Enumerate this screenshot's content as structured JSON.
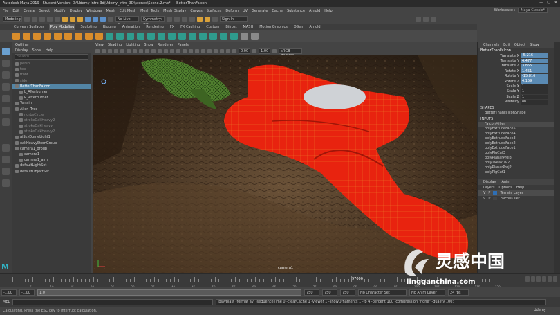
{
  "titlebar": {
    "title": "Autodesk Maya 2019 - Student Version: D:\\Udemy Intro 3d\\Udemy_Intro_3D\\scenes\\Scene.2.mb*   ---   BetterThanFalcon",
    "controls": [
      "—",
      "▢",
      "✕"
    ]
  },
  "menubar": {
    "items": [
      "File",
      "Edit",
      "Create",
      "Select",
      "Modify",
      "Display",
      "Windows",
      "Mesh",
      "Edit Mesh",
      "Mesh Tools",
      "Mesh Display",
      "Curves",
      "Surfaces",
      "Deform",
      "UV",
      "Generate",
      "Cache",
      "Substance",
      "Arnold",
      "Help"
    ],
    "workspace_label": "Workspace :",
    "workspace_value": "Maya Classic*"
  },
  "statusline": {
    "mode": "Modeling",
    "live_surface": "No Live Surface",
    "symmetry": "Symmetry: Off",
    "signin": "Sign In"
  },
  "shelf": {
    "tabs": [
      "Curves / Surfaces",
      "Poly Modeling",
      "Sculpting",
      "Rigging",
      "Animation",
      "Rendering",
      "FX",
      "FX Caching",
      "Custom",
      "Bifrost",
      "MASH",
      "Motion Graphics",
      "XGen",
      "Arnold"
    ],
    "active_tab": "Poly Modeling"
  },
  "outliner": {
    "title": "Outliner",
    "menu": [
      "Display",
      "Show",
      "Help"
    ],
    "search_placeholder": "Search...",
    "items": [
      {
        "label": "persp",
        "dim": true,
        "sel": false
      },
      {
        "label": "top",
        "dim": true,
        "sel": false
      },
      {
        "label": "front",
        "dim": true,
        "sel": false
      },
      {
        "label": "side",
        "dim": true,
        "sel": false
      },
      {
        "label": "BetterThanFalcon",
        "dim": false,
        "sel": true
      },
      {
        "label": "L_Afterburner",
        "dim": false,
        "sel": false
      },
      {
        "label": "R_Afterburner",
        "dim": false,
        "sel": false
      },
      {
        "label": "Terrain",
        "dim": false,
        "sel": false
      },
      {
        "label": "Alien_Tree",
        "dim": false,
        "sel": false
      },
      {
        "label": "nurbsCircle",
        "dim": true,
        "sel": false
      },
      {
        "label": "strokeOakHeavy2",
        "dim": true,
        "sel": false
      },
      {
        "label": "strokeOakHeavy",
        "dim": true,
        "sel": false
      },
      {
        "label": "strokeOakHeavy2",
        "dim": true,
        "sel": false
      },
      {
        "label": "aiSkyDomeLight1",
        "dim": false,
        "sel": false
      },
      {
        "label": "oakHeavyStemGroup",
        "dim": false,
        "sel": false
      },
      {
        "label": "camera1_group",
        "dim": false,
        "sel": false
      },
      {
        "label": "camera1",
        "dim": false,
        "sel": false
      },
      {
        "label": "camera1_aim",
        "dim": false,
        "sel": false
      },
      {
        "label": "defaultLightSet",
        "dim": false,
        "sel": false
      },
      {
        "label": "defaultObjectSet",
        "dim": false,
        "sel": false
      }
    ]
  },
  "viewport": {
    "menu": [
      "View",
      "Shading",
      "Lighting",
      "Show",
      "Renderer",
      "Panels"
    ],
    "field_value": "0.00",
    "field_value2": "1.00",
    "colorspace": "sRGB gamma",
    "camera_label": "camera1"
  },
  "channelbox": {
    "menu": [
      "Channels",
      "Edit",
      "Object",
      "Show"
    ],
    "object": "BetterThanFalcon",
    "channels": [
      {
        "name": "Translate X",
        "value": "-5.216"
      },
      {
        "name": "Translate Y",
        "value": "4.477"
      },
      {
        "name": "Translate Z",
        "value": "3.855"
      },
      {
        "name": "Rotate X",
        "value": "1.451"
      },
      {
        "name": "Rotate Y",
        "value": "-15.816"
      },
      {
        "name": "Rotate Z",
        "value": "4.159"
      },
      {
        "name": "Scale X",
        "value": "1"
      },
      {
        "name": "Scale Y",
        "value": "1"
      },
      {
        "name": "Scale Z",
        "value": "1"
      },
      {
        "name": "Visibility",
        "value": "on"
      }
    ],
    "shapes_label": "SHAPES",
    "shape_name": "BetterThanFalconShape",
    "inputs_label": "INPUTS",
    "inputs": [
      "FalconMiller",
      "polyExtrudeFace5",
      "polyExtrudeFace4",
      "polyExtrudeFace3",
      "polyExtrudeFace2",
      "polyExtrudeFace1",
      "polyPlgCut3",
      "polyPlanarProj3",
      "polyTweakUV2",
      "polyPlanarProj2",
      "polyPlgCut1"
    ],
    "layer_tabs": [
      "Display",
      "Anim"
    ],
    "layer_menu": [
      "Layers",
      "Options",
      "Help"
    ],
    "layers": [
      {
        "vis": "V",
        "p": "P",
        "name": "Terrain_Layer",
        "color": "#2e6fb5"
      },
      {
        "vis": "V",
        "p": "P",
        "name": "FalconKiller",
        "color": "#444444"
      }
    ]
  },
  "timeslider": {
    "tick_labels": [
      "5",
      "10",
      "15",
      "20",
      "25",
      "30",
      "35",
      "40",
      "45",
      "50",
      "55",
      "60",
      "65",
      "70",
      "75",
      "80",
      "85",
      "90",
      "95",
      "100",
      "105",
      "110",
      "115",
      "120"
    ],
    "current_frame": "97000"
  },
  "rangebar": {
    "start": "-1.00",
    "start2": "-1.00",
    "slider_label": "1.0",
    "end": "750",
    "end2": "750",
    "end3": "750",
    "char_set": "No Character Set",
    "anim_layer": "No Anim Layer",
    "fps": "24 fps"
  },
  "cmdline": {
    "lang": "MEL",
    "output": "playblast -format avi -sequenceTime 0 -clearCache 1 -viewer 1 -showOrnaments 1 -fp 4 -percent 100 -compression \"none\" -quality 100;"
  },
  "helpline": {
    "text": "Calculating.    Press the ESC key to interrupt calculation."
  },
  "logo": "M",
  "watermark": {
    "title": "灵感中国",
    "url": "lingganchina.com"
  },
  "udemy": "Udemy",
  "colors": {
    "accent_blue": "#5285a6",
    "channel_blue": "#5a8ab3",
    "ship_red": "#e8230f",
    "maya_logo": "#32b3c4"
  }
}
